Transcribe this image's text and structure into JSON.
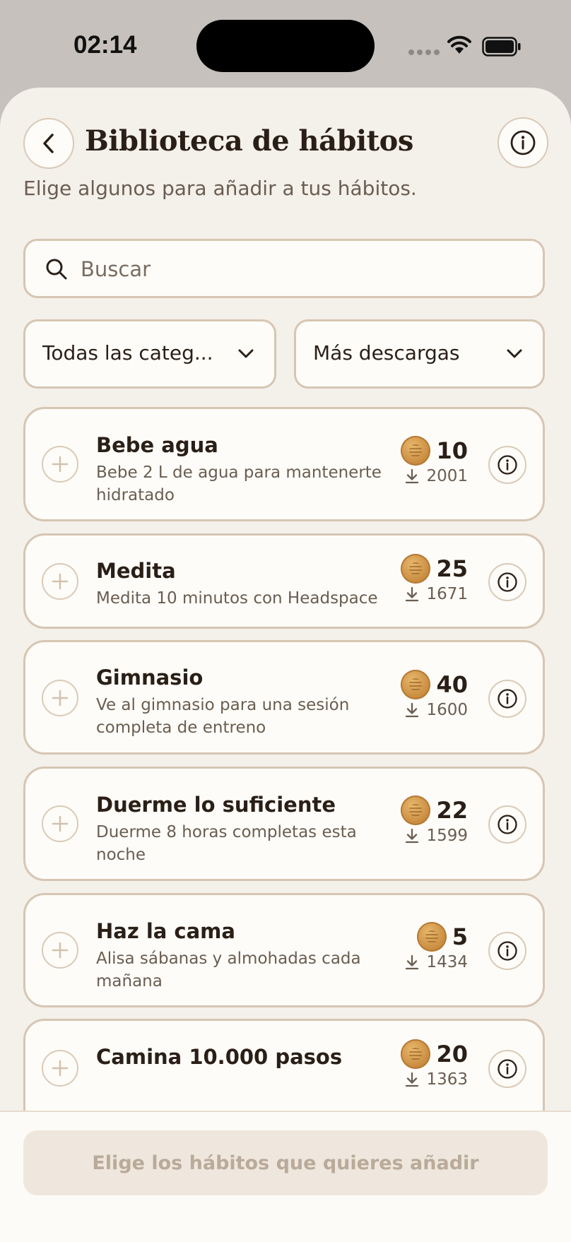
{
  "status_bar": {
    "time": "02:14"
  },
  "header": {
    "title": "Biblioteca de hábitos",
    "subtitle": "Elige algunos para añadir a tus hábitos."
  },
  "search": {
    "placeholder": "Buscar",
    "value": ""
  },
  "filters": {
    "category": "Todas las categ...",
    "sort": "Más descargas"
  },
  "habits": [
    {
      "title": "Bebe agua",
      "description": "Bebe 2 L de agua para mantenerte hidratado",
      "points": "10",
      "downloads": "2001"
    },
    {
      "title": "Medita",
      "description": "Medita 10 minutos con Headspace",
      "points": "25",
      "downloads": "1671"
    },
    {
      "title": "Gimnasio",
      "description": "Ve al gimnasio para una sesión completa de entreno",
      "points": "40",
      "downloads": "1600"
    },
    {
      "title": "Duerme lo suficiente",
      "description": "Duerme 8 horas completas esta noche",
      "points": "22",
      "downloads": "1599"
    },
    {
      "title": "Haz la cama",
      "description": "Alisa sábanas y almohadas cada mañana",
      "points": "5",
      "downloads": "1434"
    },
    {
      "title": "Camina 10.000 pasos",
      "description": "",
      "points": "20",
      "downloads": "1363"
    }
  ],
  "footer": {
    "cta_label": "Elige los hábitos que quieres añadir"
  },
  "colors": {
    "background": "#f4f0ea",
    "card_border": "#d6c6b3",
    "text": "#2a1f17",
    "muted": "#6a5d51",
    "coin": "#c7893d"
  }
}
